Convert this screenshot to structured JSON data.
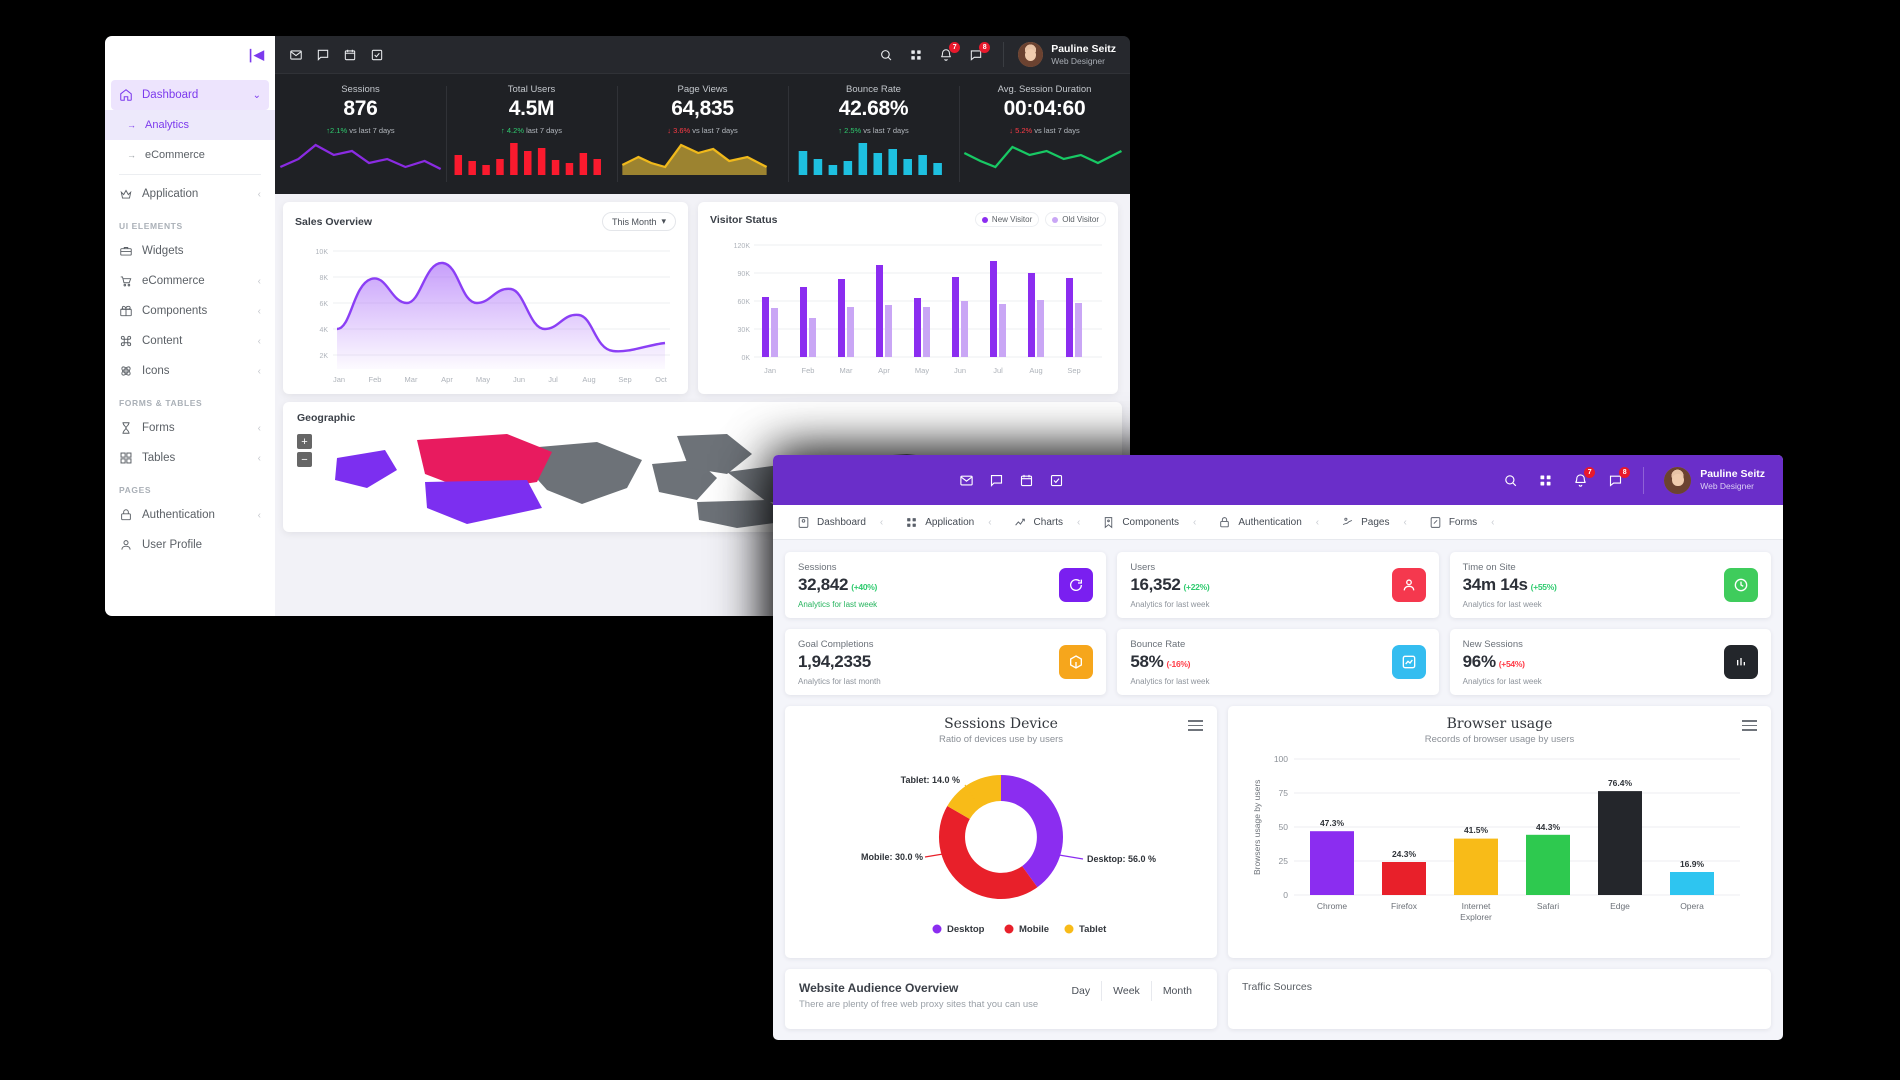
{
  "back_window": {
    "sidebar": {
      "collapse_icon": "collapse-icon",
      "items": [
        {
          "label": "Dashboard",
          "icon": "home-icon",
          "caret": "⌄",
          "state": "active"
        },
        {
          "label": "Analytics",
          "icon": "arrow-icon",
          "state": "sub-active"
        },
        {
          "label": "eCommerce",
          "icon": "arrow-icon",
          "state": "sub"
        },
        {
          "label": "Application",
          "icon": "crown-icon",
          "caret": "‹"
        }
      ],
      "section_ui": "UI ELEMENTS",
      "ui_items": [
        {
          "label": "Widgets",
          "icon": "toolbox-icon",
          "caret": ""
        },
        {
          "label": "eCommerce",
          "icon": "cart-icon",
          "caret": "‹"
        },
        {
          "label": "Components",
          "icon": "gift-icon",
          "caret": "‹"
        },
        {
          "label": "Content",
          "icon": "command-icon",
          "caret": "‹"
        },
        {
          "label": "Icons",
          "icon": "atom-icon",
          "caret": "‹"
        }
      ],
      "section_forms": "FORMS & TABLES",
      "form_items": [
        {
          "label": "Forms",
          "icon": "hourglass-icon",
          "caret": "‹"
        },
        {
          "label": "Tables",
          "icon": "grid-icon",
          "caret": "‹"
        }
      ],
      "section_pages": "PAGES",
      "page_items": [
        {
          "label": "Authentication",
          "icon": "lock-icon",
          "caret": "‹"
        },
        {
          "label": "User Profile",
          "icon": "user-icon",
          "caret": ""
        }
      ]
    },
    "topbar": {
      "left_icons": [
        "mail-icon",
        "chat-icon",
        "calendar-icon",
        "checklist-icon"
      ],
      "right_icons": [
        "search-icon",
        "apps-icon",
        "bell-icon",
        "message-icon"
      ],
      "bell_badge": "7",
      "message_badge": "8",
      "user_name": "Pauline Seitz",
      "user_role": "Web Designer"
    },
    "kpis": [
      {
        "title": "Sessions",
        "value": "876",
        "delta": "2.1%",
        "delta_dir": "up",
        "delta_text": "vs last 7 days",
        "color": "#8a2be2",
        "spark": "line"
      },
      {
        "title": "Total Users",
        "value": "4.5M",
        "delta": "4.2%",
        "delta_dir": "up",
        "delta_text": "last 7 days",
        "color": "#fa1a2e",
        "spark": "bars"
      },
      {
        "title": "Page Views",
        "value": "64,835",
        "delta": "3.6%",
        "delta_dir": "down",
        "delta_text": "vs last 7 days",
        "color": "#f0b91b",
        "spark": "area"
      },
      {
        "title": "Bounce Rate",
        "value": "42.68%",
        "delta": "2.5%",
        "delta_dir": "up",
        "delta_text": "vs last 7 days",
        "color": "#1ec0e0",
        "spark": "bars"
      },
      {
        "title": "Avg. Session Duration",
        "value": "00:04:60",
        "delta": "5.2%",
        "delta_dir": "down",
        "delta_text": "vs last 7 days",
        "color": "#18c964",
        "spark": "line"
      }
    ],
    "sales_overview": {
      "title": "Sales Overview",
      "filter": "This Month"
    },
    "visitor_status": {
      "title": "Visitor Status",
      "legend_new": "New Visitor",
      "legend_old": "Old Visitor"
    },
    "geographic": {
      "title": "Geographic",
      "zoom_in": "+",
      "zoom_out": "−"
    }
  },
  "front_window": {
    "topbar": {
      "left_icons": [
        "mail-icon",
        "chat-icon",
        "calendar-icon",
        "checklist-icon"
      ],
      "right_icons": [
        "search-icon",
        "apps-icon",
        "bell-icon",
        "message-icon"
      ],
      "bell_badge": "7",
      "message_badge": "8",
      "user_name": "Pauline Seitz",
      "user_role": "Web Designer",
      "accent": "#6a2ec9"
    },
    "nav": [
      {
        "label": "Dashboard",
        "icon": "dashboard-icon",
        "caret": "‹"
      },
      {
        "label": "Application",
        "icon": "apps-icon",
        "caret": "‹"
      },
      {
        "label": "Charts",
        "icon": "chart-icon",
        "caret": "‹"
      },
      {
        "label": "Components",
        "icon": "bookmark-icon",
        "caret": "‹"
      },
      {
        "label": "Authentication",
        "icon": "lock-icon",
        "caret": "‹"
      },
      {
        "label": "Pages",
        "icon": "pages-icon",
        "caret": "‹"
      },
      {
        "label": "Forms",
        "icon": "form-icon",
        "caret": "‹"
      }
    ],
    "stat_cards": [
      {
        "title": "Sessions",
        "value": "32,842",
        "delta": "(+40%)",
        "delta_dir": "up",
        "sub": "Analytics for last week",
        "sub_green": true,
        "icon": "refresh-icon",
        "icon_bg": "#7a1ff0"
      },
      {
        "title": "Users",
        "value": "16,352",
        "delta": "(+22%)",
        "delta_dir": "up",
        "sub": "Analytics for last week",
        "sub_green": false,
        "icon": "users-icon",
        "icon_bg": "#f5384e"
      },
      {
        "title": "Time on Site",
        "value": "34m 14s",
        "delta": "(+55%)",
        "delta_dir": "up",
        "sub": "Analytics for last week",
        "sub_green": false,
        "icon": "clock-icon",
        "icon_bg": "#3fcc5c"
      },
      {
        "title": "Goal Completions",
        "value": "1,94,2335",
        "delta": "",
        "delta_dir": "",
        "sub": "Analytics for last month",
        "sub_green": false,
        "icon": "box-icon",
        "icon_bg": "#f6a61c"
      },
      {
        "title": "Bounce Rate",
        "value": "58%",
        "delta": "(-16%)",
        "delta_dir": "down",
        "sub": "Analytics for last week",
        "sub_green": false,
        "icon": "trend-icon",
        "icon_bg": "#34bdf0"
      },
      {
        "title": "New Sessions",
        "value": "96%",
        "delta": "(+54%)",
        "delta_dir": "down",
        "sub": "Analytics for last week",
        "sub_green": false,
        "icon": "bars-icon",
        "icon_bg": "#23262b"
      }
    ],
    "website_audience": {
      "title": "Website Audience Overview",
      "subtitle": "There are plenty of free web proxy sites that you can use",
      "segments": [
        "Day",
        "Week",
        "Month"
      ]
    },
    "traffic_sources": {
      "title": "Traffic Sources"
    }
  },
  "chart_data": [
    {
      "type": "area",
      "title": "Sales Overview",
      "categories": [
        "Jan",
        "Feb",
        "Mar",
        "Apr",
        "May",
        "Jun",
        "Jul",
        "Aug",
        "Sep",
        "Oct"
      ],
      "values": [
        4000,
        8000,
        6000,
        9000,
        6000,
        7000,
        4000,
        5000,
        2500,
        3000
      ],
      "ylabel": "",
      "xlabel": "",
      "ytick_labels": [
        "2K",
        "4K",
        "6K",
        "8K",
        "10K"
      ],
      "ylim": [
        2000,
        10000
      ],
      "grid": true,
      "color": "#8b3ff5"
    },
    {
      "type": "bar",
      "title": "Visitor Status",
      "categories": [
        "Jan",
        "Feb",
        "Mar",
        "Apr",
        "May",
        "Jun",
        "Jul",
        "Aug",
        "Sep"
      ],
      "series": [
        {
          "name": "New Visitor",
          "values": [
            64000,
            75000,
            84000,
            99000,
            63000,
            86000,
            103000,
            90000,
            85000
          ],
          "color": "#8b2df0"
        },
        {
          "name": "Old Visitor",
          "values": [
            52000,
            42000,
            53000,
            56000,
            54000,
            60000,
            57000,
            61000,
            58000
          ],
          "color": "#c9a6f5"
        }
      ],
      "ytick_labels": [
        "0K",
        "30K",
        "60K",
        "90K",
        "120K"
      ],
      "ylim": [
        0,
        120000
      ],
      "grid": true,
      "legend_position": "top-right"
    },
    {
      "type": "pie",
      "title": "Sessions Device",
      "subtitle": "Ratio of devices use by users",
      "labels": [
        "Desktop",
        "Mobile",
        "Tablet"
      ],
      "values": [
        56.0,
        30.0,
        14.0
      ],
      "value_labels": [
        "Desktop: 56.0 %",
        "Mobile: 30.0 %",
        "Tablet: 14.0 %"
      ],
      "colors": [
        "#8b2df0",
        "#e8202a",
        "#f8bb18"
      ],
      "legend_position": "bottom"
    },
    {
      "type": "bar",
      "title": "Browser usage",
      "subtitle": "Records of browser usage by users",
      "categories": [
        "Chrome",
        "Firefox",
        "Internet Explorer",
        "Safari",
        "Edge",
        "Opera"
      ],
      "values": [
        47.3,
        24.3,
        41.5,
        44.3,
        76.4,
        16.9
      ],
      "data_labels": [
        "47.3%",
        "24.3%",
        "41.5%",
        "44.3%",
        "76.4%",
        "16.9%"
      ],
      "colors": [
        "#8b2df0",
        "#e8202a",
        "#f8bb18",
        "#2ec94f",
        "#24262b",
        "#2ec5f0"
      ],
      "ylabel": "Browsers usage by users",
      "ytick_labels": [
        "0",
        "25",
        "50",
        "75",
        "100"
      ],
      "ylim": [
        0,
        100
      ],
      "grid": true
    }
  ]
}
